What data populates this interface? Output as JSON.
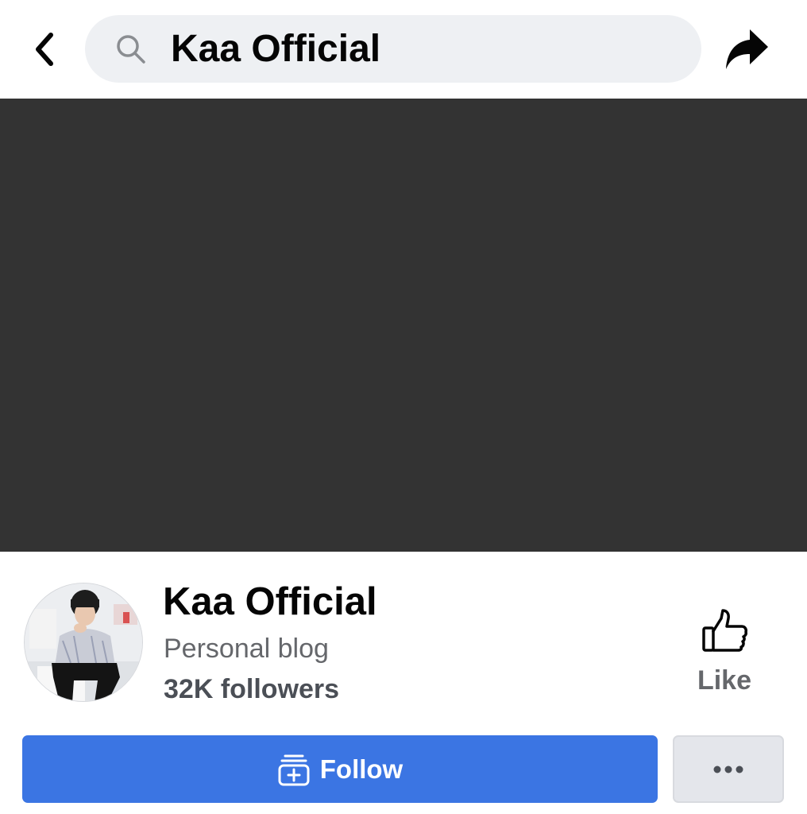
{
  "header": {
    "search_query": "Kaa Official",
    "back_icon": "chevron-left-icon",
    "search_icon": "search-icon",
    "share_icon": "share-arrow-icon"
  },
  "cover_photo": {
    "color": "#333333"
  },
  "profile": {
    "avatar_icon": "profile-photo",
    "name": "Kaa Official",
    "category": "Personal blog",
    "followers": "32K followers"
  },
  "actions": {
    "like_label": "Like",
    "like_icon": "thumbs-up-icon",
    "follow_label": "Follow",
    "follow_icon": "follow-box-icon",
    "more_icon": "more-dots-icon"
  },
  "colors": {
    "accent_blue": "#3b75e3",
    "search_bg": "#eef0f3",
    "secondary_text": "#65676b",
    "more_button_bg": "#e4e6eb"
  }
}
